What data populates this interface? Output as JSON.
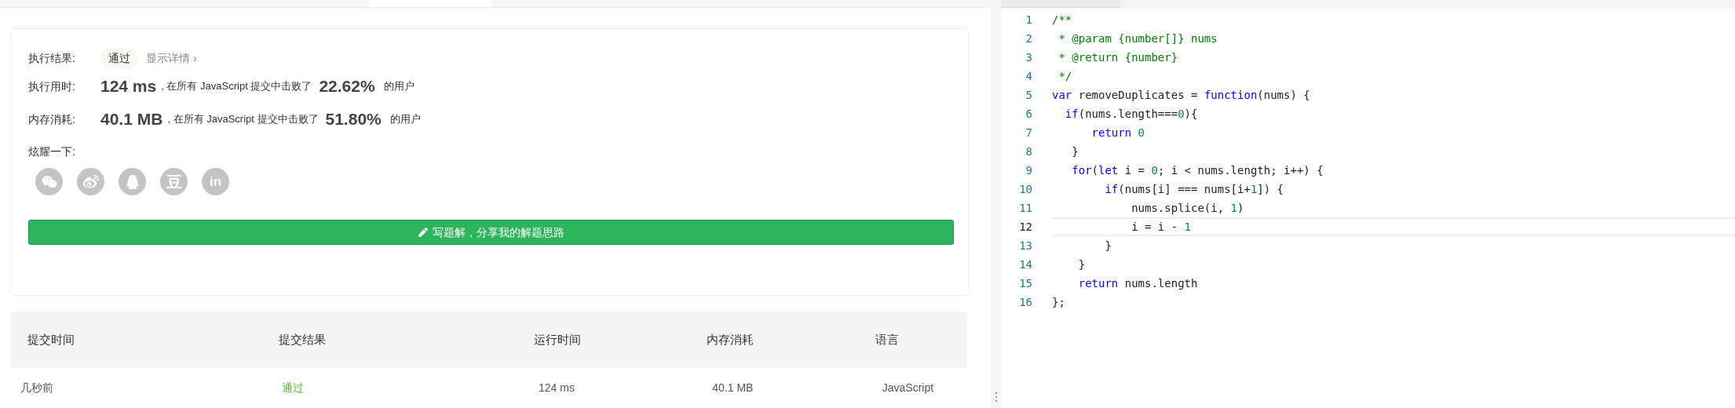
{
  "result": {
    "label": "执行结果:",
    "status": "通过",
    "details_link": "显示详情",
    "chevron": "›"
  },
  "stats": [
    {
      "label": "执行用时:",
      "value": "124 ms",
      "text": ", 在所有 JavaScript 提交中击败了",
      "percent": "22.62%",
      "suffix": "的用户"
    },
    {
      "label": "内存消耗:",
      "value": "40.1 MB",
      "text": ", 在所有 JavaScript 提交中击败了",
      "percent": "51.80%",
      "suffix": "的用户"
    }
  ],
  "share": {
    "label": "炫耀一下:",
    "icons": [
      {
        "kind": "wechat"
      },
      {
        "kind": "weibo"
      },
      {
        "kind": "qq"
      },
      {
        "kind": "douban",
        "glyph": "豆"
      },
      {
        "kind": "linkedin",
        "glyph": "in"
      }
    ]
  },
  "write_button": "写题解，分享我的解题思路",
  "table": {
    "columns": [
      "提交时间",
      "提交结果",
      "运行时间",
      "内存消耗",
      "语言"
    ],
    "rows": [
      {
        "cells": [
          "几秒前",
          "通过",
          "124 ms",
          "40.1 MB",
          "JavaScript"
        ],
        "passed": true
      }
    ]
  },
  "code": {
    "lines": [
      {
        "number": "1",
        "active": false,
        "tokens": [
          {
            "kind": "comment",
            "text": "/**"
          }
        ]
      },
      {
        "number": "2",
        "active": false,
        "tokens": [
          {
            "kind": "comment",
            "text": " * @param {number[]} nums"
          }
        ]
      },
      {
        "number": "3",
        "active": false,
        "tokens": [
          {
            "kind": "comment",
            "text": " * @return {number}"
          }
        ]
      },
      {
        "number": "4",
        "active": false,
        "tokens": [
          {
            "kind": "comment",
            "text": " */"
          }
        ]
      },
      {
        "number": "5",
        "active": false,
        "tokens": [
          {
            "kind": "keyword",
            "text": "var"
          },
          {
            "kind": "plain",
            "text": " removeDuplicates = "
          },
          {
            "kind": "keyword",
            "text": "function"
          },
          {
            "kind": "plain",
            "text": "(nums) {"
          }
        ]
      },
      {
        "number": "6",
        "active": false,
        "tokens": [
          {
            "kind": "keyword",
            "text": "  if"
          },
          {
            "kind": "plain",
            "text": "(nums.length==="
          },
          {
            "kind": "number",
            "text": "0"
          },
          {
            "kind": "plain",
            "text": "){"
          }
        ]
      },
      {
        "number": "7",
        "active": false,
        "tokens": [
          {
            "kind": "keyword",
            "text": "      return"
          },
          {
            "kind": "number",
            "text": " 0"
          }
        ]
      },
      {
        "number": "8",
        "active": false,
        "tokens": [
          {
            "kind": "plain",
            "text": "   }"
          }
        ]
      },
      {
        "number": "9",
        "active": false,
        "tokens": [
          {
            "kind": "keyword",
            "text": "   for"
          },
          {
            "kind": "plain",
            "text": "("
          },
          {
            "kind": "keyword",
            "text": "let"
          },
          {
            "kind": "plain",
            "text": " i = "
          },
          {
            "kind": "number",
            "text": "0"
          },
          {
            "kind": "plain",
            "text": "; i < nums.length; i++) {"
          }
        ]
      },
      {
        "number": "10",
        "active": false,
        "tokens": [
          {
            "kind": "keyword",
            "text": "        if"
          },
          {
            "kind": "plain",
            "text": "(nums[i] === nums[i+"
          },
          {
            "kind": "number",
            "text": "1"
          },
          {
            "kind": "plain",
            "text": "]) {"
          }
        ]
      },
      {
        "number": "11",
        "active": false,
        "tokens": [
          {
            "kind": "plain",
            "text": "            nums.splice(i, "
          },
          {
            "kind": "number",
            "text": "1"
          },
          {
            "kind": "plain",
            "text": ")"
          }
        ]
      },
      {
        "number": "12",
        "active": true,
        "tokens": [
          {
            "kind": "plain",
            "text": "            i = i - "
          },
          {
            "kind": "number",
            "text": "1"
          }
        ]
      },
      {
        "number": "13",
        "active": false,
        "tokens": [
          {
            "kind": "plain",
            "text": "        }"
          }
        ]
      },
      {
        "number": "14",
        "active": false,
        "tokens": [
          {
            "kind": "plain",
            "text": "    }"
          }
        ]
      },
      {
        "number": "15",
        "active": false,
        "tokens": [
          {
            "kind": "keyword",
            "text": "    return"
          },
          {
            "kind": "plain",
            "text": " nums.length"
          }
        ]
      },
      {
        "number": "16",
        "active": false,
        "tokens": [
          {
            "kind": "plain",
            "text": "};"
          }
        ]
      }
    ]
  }
}
